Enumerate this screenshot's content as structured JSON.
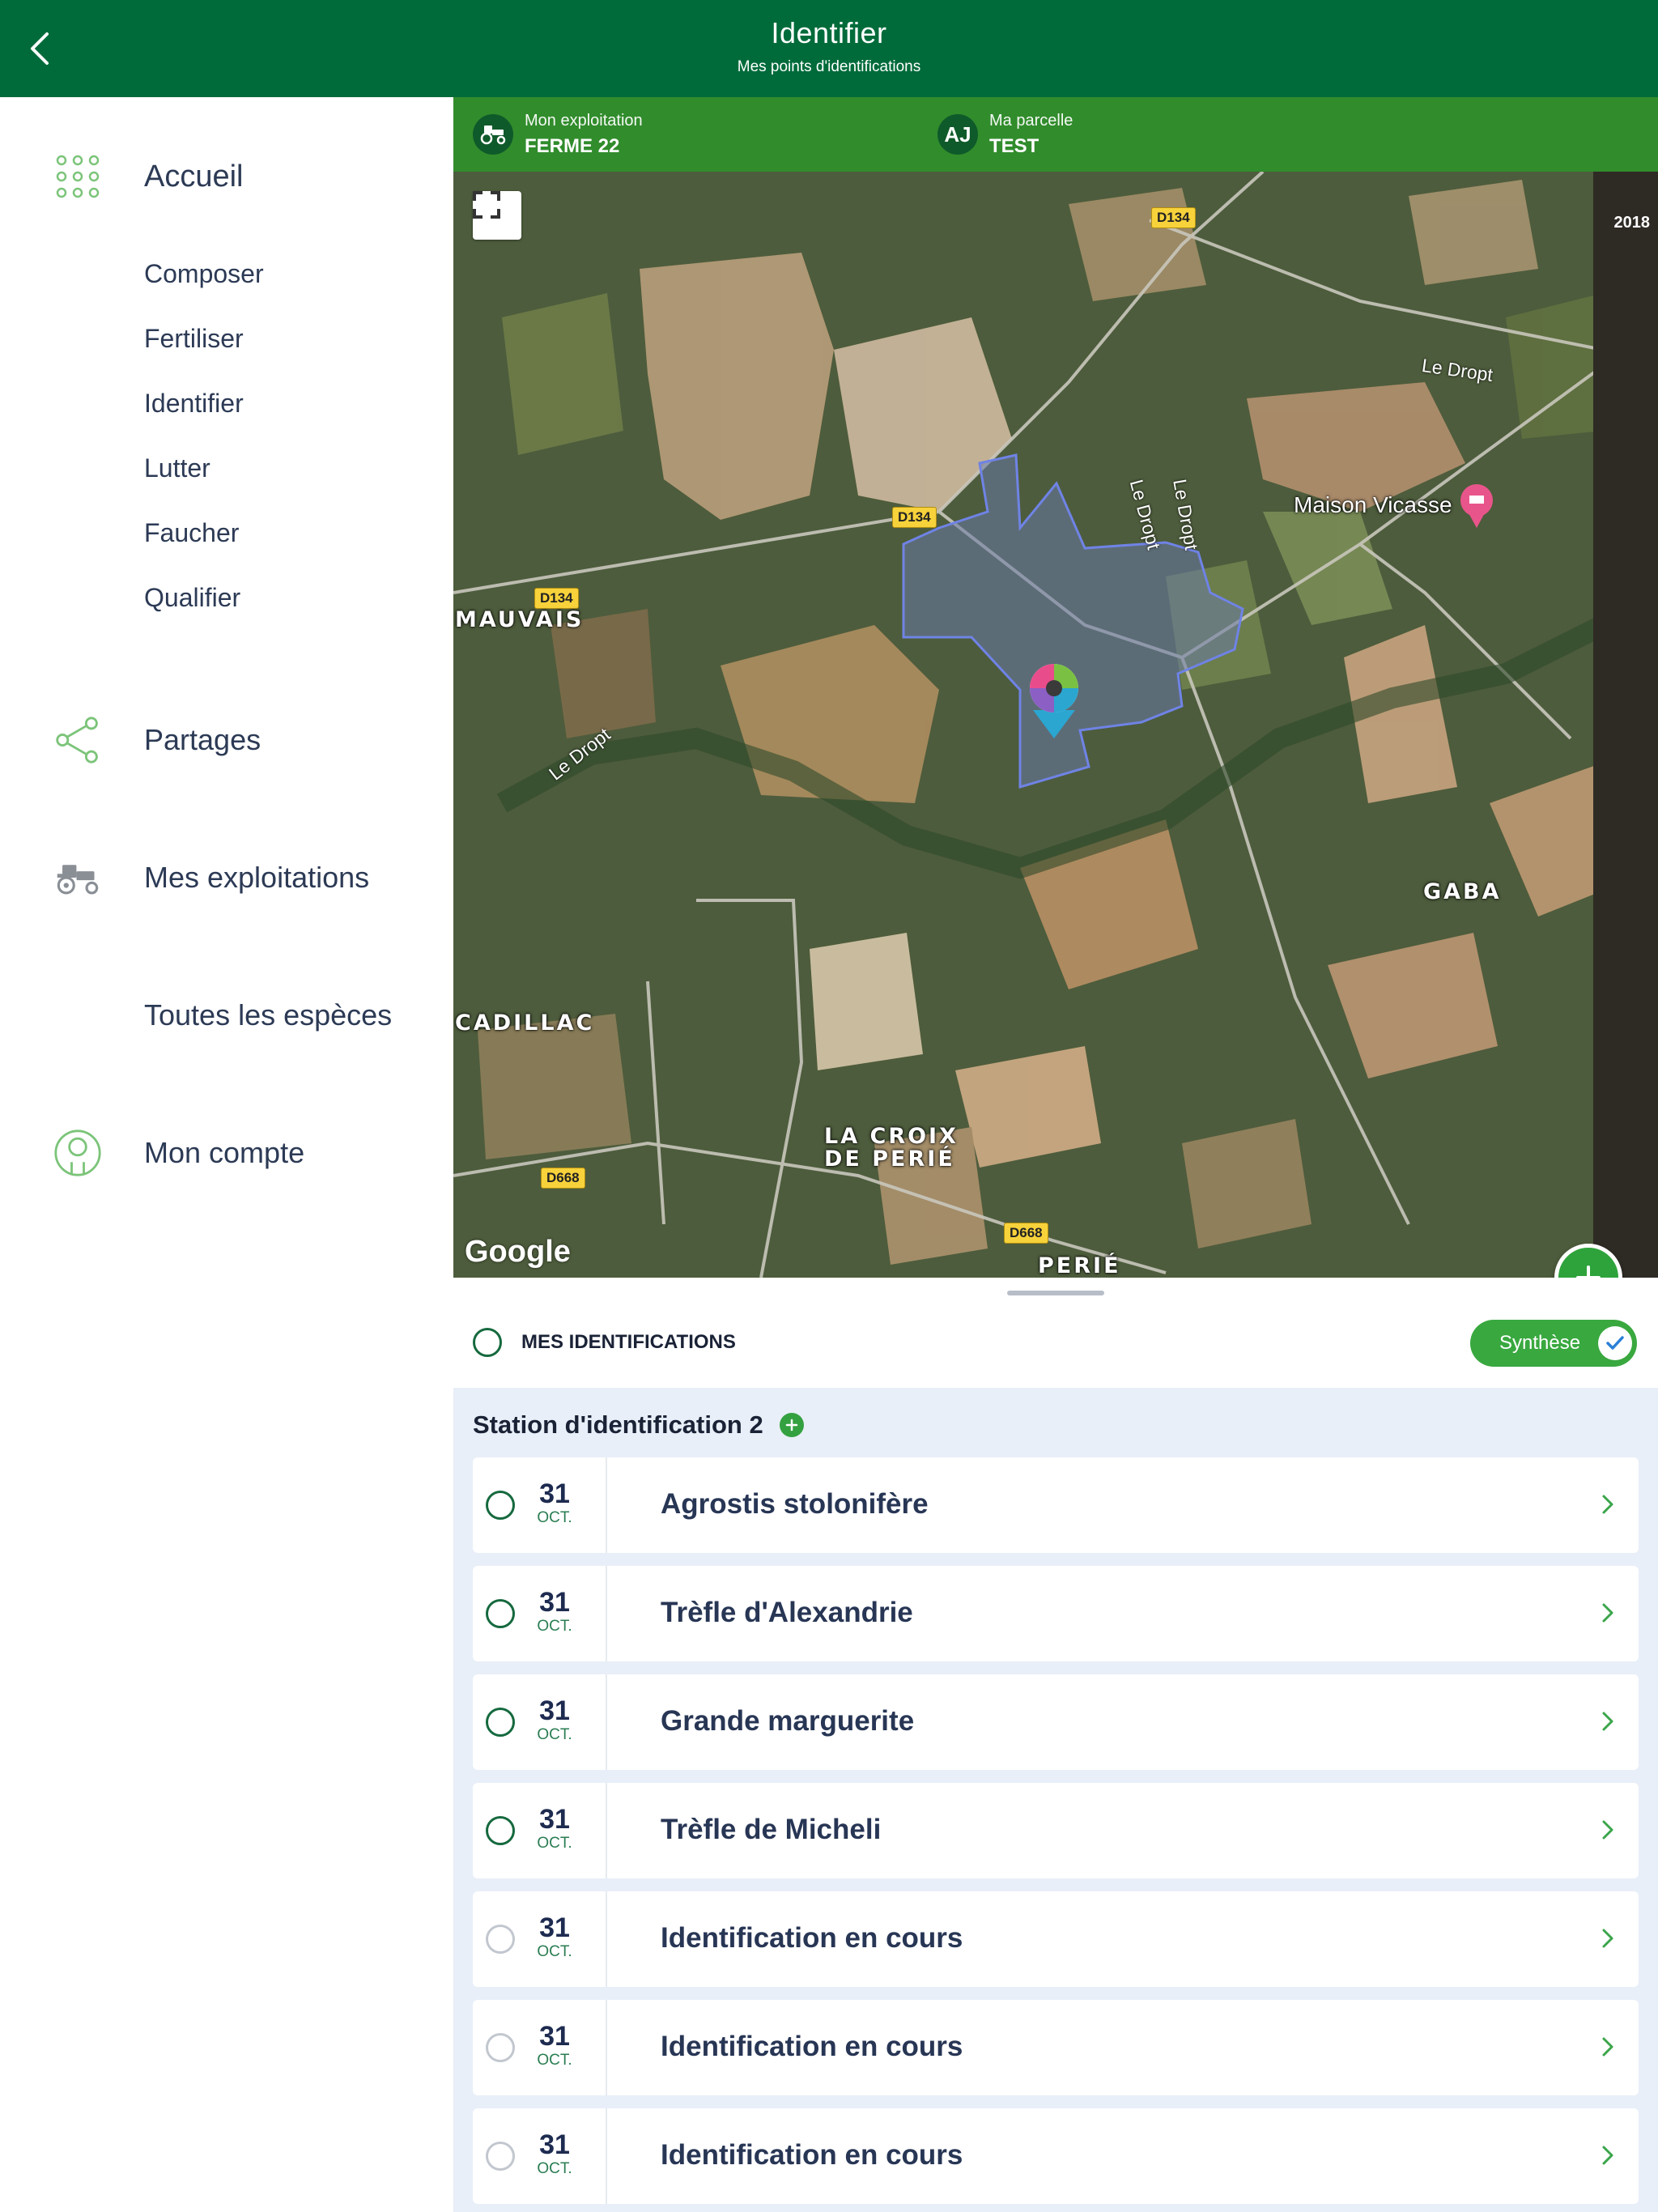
{
  "header": {
    "title": "Identifier",
    "subtitle": "Mes points d'identifications"
  },
  "sidebar": {
    "home": "Accueil",
    "sub_items": [
      "Composer",
      "Fertiliser",
      "Identifier",
      "Lutter",
      "Faucher",
      "Qualifier"
    ],
    "shares": "Partages",
    "farms": "Mes exploitations",
    "species": "Toutes les espèces",
    "account": "Mon compte"
  },
  "farmbar": {
    "farm_caption": "Mon exploitation",
    "farm_value": "FERME 22",
    "plot_caption": "Ma parcelle",
    "plot_value": "TEST",
    "plot_initials": "AJ"
  },
  "map": {
    "year": "2018",
    "attribution": "Google",
    "roads": [
      "D134",
      "D134",
      "D134",
      "D668",
      "D668"
    ],
    "places": [
      "MAUVAIS",
      "GABA",
      "CADILLAC",
      "LA CROIX",
      "DE PERIÉ",
      "PERIÉ"
    ],
    "rivers": [
      "Le Dropt",
      "Le Dropt",
      "Le Dropt",
      "Le Dropt"
    ],
    "poi": "Maison Vicasse"
  },
  "panel": {
    "my_identifications": "MES IDENTIFICATIONS",
    "synthese": "Synthèse",
    "station": "Station d'identification 2"
  },
  "identifications": [
    {
      "day": "31",
      "month": "OCT.",
      "name": "Agrostis stolonifère"
    },
    {
      "day": "31",
      "month": "OCT.",
      "name": "Trèfle d'Alexandrie"
    },
    {
      "day": "31",
      "month": "OCT.",
      "name": "Grande marguerite"
    },
    {
      "day": "31",
      "month": "OCT.",
      "name": "Trèfle de Micheli"
    },
    {
      "day": "31",
      "month": "OCT.",
      "name": "Identification en cours"
    },
    {
      "day": "31",
      "month": "OCT.",
      "name": "Identification en cours"
    },
    {
      "day": "31",
      "month": "OCT.",
      "name": "Identification en cours"
    }
  ],
  "colors": {
    "header": "#006b3a",
    "farmbar": "#318c2c",
    "accent": "#39a83f",
    "list_bg": "#e8eff8"
  }
}
